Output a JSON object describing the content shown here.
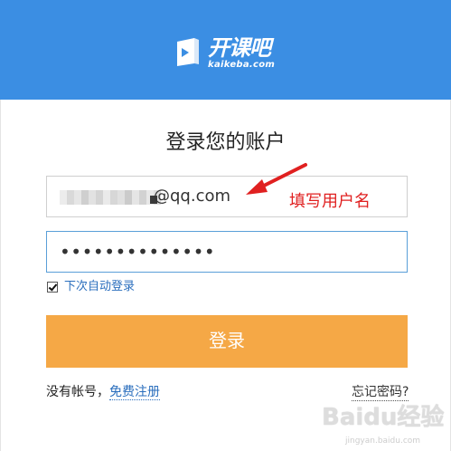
{
  "header": {
    "logo_cn": "开课吧",
    "logo_en": "kaikeba.com",
    "bg_color": "#3b8ee3"
  },
  "form": {
    "title": "登录您的账户",
    "username_suffix": "@qq.com",
    "password_mask": "••••••••••••••",
    "remember_label": "下次自动登录",
    "remember_checked": true,
    "login_label": "登录",
    "login_color": "#f5a846"
  },
  "footer": {
    "no_account": "没有帐号，",
    "register": "免费注册",
    "forgot": "忘记密码?"
  },
  "annotation": {
    "text": "填写用户名",
    "color": "#e02020"
  },
  "watermark": {
    "main": "Baidu经验",
    "sub": "jingyan.baidu.com"
  }
}
